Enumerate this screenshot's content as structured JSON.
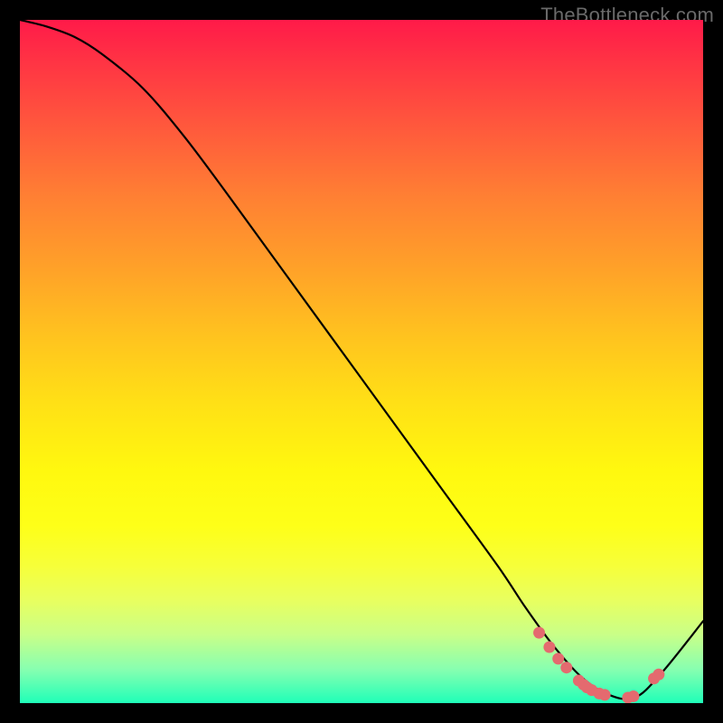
{
  "watermark": "TheBottleneck.com",
  "chart_data": {
    "type": "line",
    "title": "",
    "xlabel": "",
    "ylabel": "",
    "xlim": [
      0,
      100
    ],
    "ylim": [
      0,
      100
    ],
    "series": [
      {
        "name": "curve",
        "x": [
          0,
          4,
          8,
          12,
          18,
          24,
          30,
          38,
          46,
          54,
          62,
          70,
          74,
          78,
          82,
          86,
          90,
          94,
          100
        ],
        "y": [
          100,
          99,
          97.5,
          95,
          90,
          83,
          75,
          64,
          53,
          42,
          31,
          20,
          14,
          8.5,
          4,
          1.3,
          0.8,
          4.5,
          12
        ]
      }
    ],
    "markers": {
      "name": "highlight-dots",
      "color": "#e46a6f",
      "x": [
        76.0,
        77.5,
        78.8,
        80.0,
        81.8,
        82.5,
        83.0,
        83.7,
        84.8,
        85.6,
        89.0,
        89.8,
        92.8,
        93.5
      ],
      "y": [
        10.3,
        8.2,
        6.5,
        5.2,
        3.3,
        2.7,
        2.3,
        1.9,
        1.4,
        1.2,
        0.8,
        1.0,
        3.6,
        4.2
      ]
    }
  }
}
